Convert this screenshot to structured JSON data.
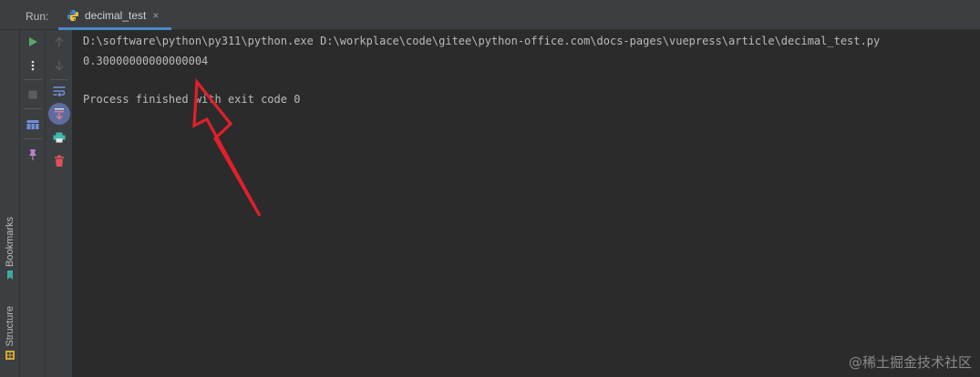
{
  "run_panel": {
    "label": "Run:",
    "tab": {
      "title": "decimal_test",
      "close_glyph": "×",
      "icon": "python-icon"
    }
  },
  "side_tabs": {
    "bookmarks": "Bookmarks",
    "structure": "Structure"
  },
  "toolbar_primary": [
    {
      "name": "rerun-button",
      "icon": "play-icon"
    },
    {
      "name": "more-button",
      "icon": "more-vertical-icon"
    },
    {
      "name": "stop-button",
      "icon": "stop-icon"
    },
    {
      "name": "layout-button",
      "icon": "layout-icon"
    },
    {
      "name": "pin-tab-button",
      "icon": "pin-icon"
    }
  ],
  "toolbar_secondary": [
    {
      "name": "scroll-up-button",
      "icon": "arrow-up-icon"
    },
    {
      "name": "scroll-down-button",
      "icon": "arrow-down-icon"
    },
    {
      "name": "soft-wrap-button",
      "icon": "soft-wrap-icon"
    },
    {
      "name": "scroll-to-end-button",
      "icon": "scroll-to-end-icon"
    },
    {
      "name": "print-button",
      "icon": "print-icon"
    },
    {
      "name": "clear-all-button",
      "icon": "trash-icon"
    }
  ],
  "console": {
    "lines": [
      "D:\\software\\python\\py311\\python.exe D:\\workplace\\code\\gitee\\python-office.com\\docs-pages\\vuepress\\article\\decimal_test.py",
      "0.30000000000000004",
      "",
      "Process finished with exit code 0"
    ]
  },
  "watermark": "@稀土掘金技术社区",
  "colors": {
    "background": "#2b2b2b",
    "panel": "#3c3f41",
    "text": "#bbbbbb",
    "accent_tab": "#4a88c7",
    "run_green": "#59a869",
    "annotation_red": "#e0202a"
  }
}
